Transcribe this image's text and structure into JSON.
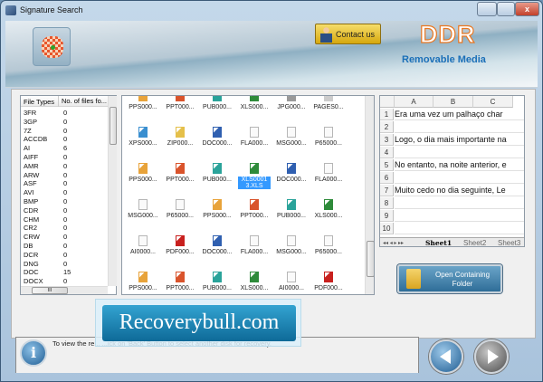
{
  "window": {
    "title": "Signature Search",
    "close": "x"
  },
  "header": {
    "contact": "Contact us",
    "brand": "DDR",
    "product": "Removable Media",
    "logo_text": "DDR"
  },
  "file_types": {
    "headers": [
      "File Types",
      "No. of files fo..."
    ],
    "rows": [
      [
        "3FR",
        "0"
      ],
      [
        "3GP",
        "0"
      ],
      [
        "7Z",
        "0"
      ],
      [
        "ACCDB",
        "0"
      ],
      [
        "AI",
        "6"
      ],
      [
        "AIFF",
        "0"
      ],
      [
        "AMR",
        "0"
      ],
      [
        "ARW",
        "0"
      ],
      [
        "ASF",
        "0"
      ],
      [
        "AVI",
        "0"
      ],
      [
        "BMP",
        "0"
      ],
      [
        "CDR",
        "0"
      ],
      [
        "CHM",
        "0"
      ],
      [
        "CR2",
        "0"
      ],
      [
        "CRW",
        "0"
      ],
      [
        "DB",
        "0"
      ],
      [
        "DCR",
        "0"
      ],
      [
        "DNG",
        "0"
      ],
      [
        "DOC",
        "15"
      ],
      [
        "DOCX",
        "0"
      ]
    ],
    "hscroll_glyph": "III"
  },
  "files": [
    [
      "PPS000...",
      "PPT000...",
      "PUB000...",
      "XLS000...",
      "JPG000...",
      "PAGES0..."
    ],
    [
      "XPS000...",
      "ZIP000...",
      "DOC000...",
      "FLA000...",
      "MSG000...",
      "P65000..."
    ],
    [
      "PPS000...",
      "PPT000...",
      "PUB000...",
      "XLS00013.XLS",
      "DOC000...",
      "FLA000..."
    ],
    [
      "MSG000...",
      "P65000...",
      "PPS000...",
      "PPT000...",
      "PUB000...",
      "XLS000..."
    ],
    [
      "AI0000...",
      "PDF000...",
      "DOC000...",
      "FLA000...",
      "MSG000...",
      "P65000..."
    ],
    [
      "PPS000...",
      "PPT000...",
      "PUB000...",
      "XLS000...",
      "AI0000...",
      "PDF000..."
    ]
  ],
  "selected_file": "XLS00013.XLS",
  "spreadsheet": {
    "columns": [
      "A",
      "B",
      "C"
    ],
    "rows": [
      "1",
      "2",
      "3",
      "4",
      "5",
      "6",
      "7",
      "8",
      "9",
      "10"
    ],
    "cells": {
      "1": "Era uma vez um palhaço char",
      "3": "Logo, o dia mais importante na",
      "5": "No entanto, na noite anterior, e",
      "7": "Muito cedo no dia seguinte, Le"
    },
    "tab_nav": "◂◂ ◂ ▸ ▸▸",
    "tabs": [
      "Sheet1",
      "Sheet2",
      "Sheet3"
    ],
    "active_tab": "Sheet1"
  },
  "open_button": "Open Containing Folder",
  "info": {
    "text": "To view the re... ...ick on 'Back' Button to select another disk for recovery.",
    "icon": "i"
  },
  "watermark": "Recoverybull.com"
}
